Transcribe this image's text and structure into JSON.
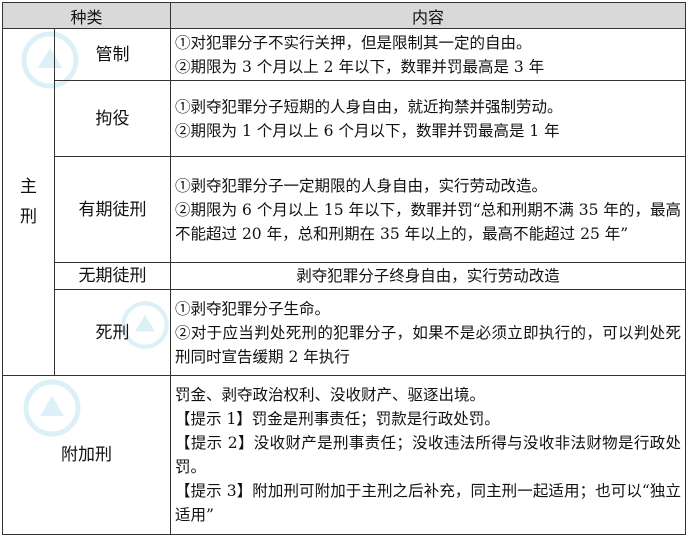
{
  "header": {
    "col1": "种类",
    "col2": "内容"
  },
  "main_category": [
    "主",
    "刑"
  ],
  "rows": [
    {
      "type": "管制",
      "lines": [
        "①对犯罪分子不实行关押，但是限制其一定的自由。",
        "②期限为 3 个月以上 2 年以下，数罪并罚最高是 3 年"
      ]
    },
    {
      "type": "拘役",
      "lines": [
        "①剥夺犯罪分子短期的人身自由，就近拘禁并强制劳动。",
        "②期限为 1 个月以上 6 个月以下，数罪并罚最高是 1 年"
      ]
    },
    {
      "type": "有期徒刑",
      "lines": [
        "①剥夺犯罪分子一定期限的人身自由，实行劳动改造。",
        "②期限为 6 个月以上 15 年以下，数罪并罚“总和刑期不满 35 年的，最高不能超过 20 年，总和刑期在 35 年以上的，最高不能超过 25 年”"
      ]
    },
    {
      "type": "无期徒刑",
      "lines": [
        "剥夺犯罪分子终身自由，实行劳动改造"
      ]
    },
    {
      "type": "死刑",
      "lines": [
        "①剥夺犯罪分子生命。",
        "②对于应当判处死刑的犯罪分子，如果不是必须立即执行的，可以判处死刑同时宣告缓期 2 年执行"
      ]
    }
  ],
  "additional": {
    "type": "附加刑",
    "lines": [
      "罚金、剥夺政治权利、没收财产、驱逐出境。",
      "【提示 1】罚金是刑事责任；罚款是行政处罚。",
      "【提示 2】没收财产是刑事责任；没收违法所得与没收非法财物是行政处罚。",
      "【提示 3】附加刑可附加于主刑之后补充，同主刑一起适用；也可以“独立适用”"
    ]
  },
  "watermark_icon": "chinaacc-logo-watermark",
  "colors": {
    "header_bg": "#d9d9d9",
    "border": "#333333",
    "watermark": "#2aa4d8"
  }
}
